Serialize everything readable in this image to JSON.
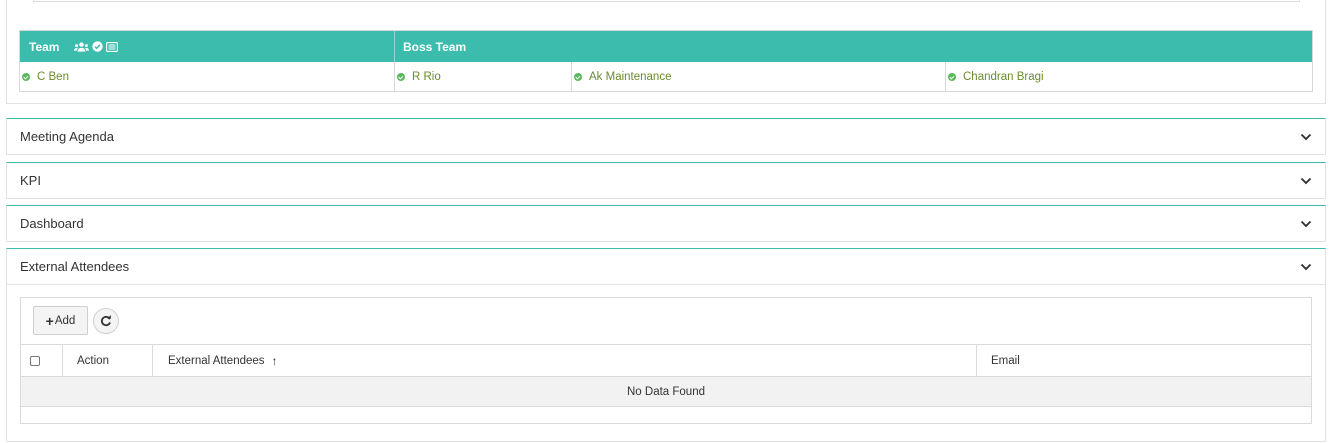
{
  "team_table": {
    "header_team": "Team",
    "header_boss": "Boss Team",
    "header_icons": [
      "users-icon",
      "check-circle-icon",
      "list-icon"
    ],
    "members": [
      {
        "name": "C Ben",
        "status": "active"
      },
      {
        "name": "R Rio",
        "status": "active"
      },
      {
        "name": "Ak Maintenance",
        "status": "active"
      },
      {
        "name": "Chandran Bragi",
        "status": "active"
      }
    ]
  },
  "accordions": [
    {
      "title": "Meeting Agenda"
    },
    {
      "title": "KPI"
    },
    {
      "title": "Dashboard"
    },
    {
      "title": "External Attendees"
    }
  ],
  "external_attendees": {
    "add_label": "Add",
    "columns": {
      "action": "Action",
      "external_attendees": "External Attendees",
      "email": "Email"
    },
    "sort_indicator": "↑",
    "empty_message": "No Data Found"
  },
  "colors": {
    "accent": "#3bbcad",
    "member_text": "#6a8c2c",
    "status_green": "#5cb85c"
  }
}
